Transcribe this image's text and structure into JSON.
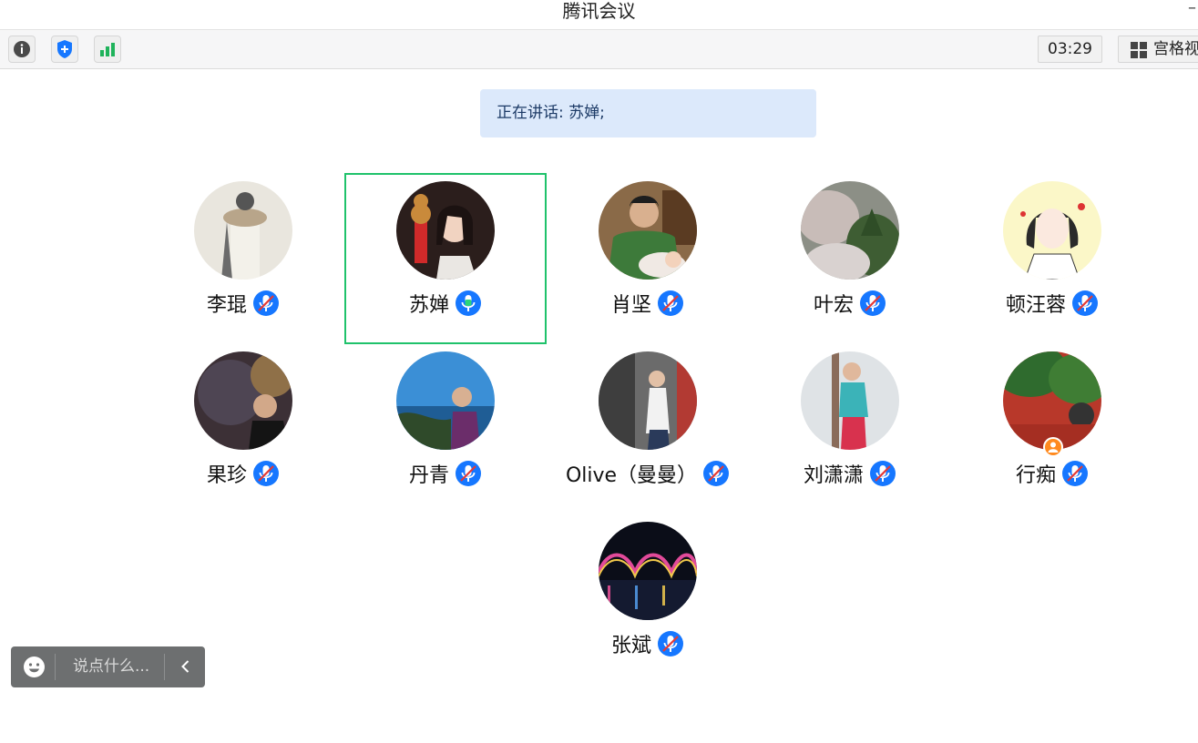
{
  "window": {
    "title": "腾讯会议",
    "minimize_glyph": "–"
  },
  "toolbar": {
    "info_icon": "info-icon",
    "security_icon": "shield-icon",
    "signal_icon": "signal-bars-icon",
    "timer": "03:29",
    "view_label": "宫格视图"
  },
  "banner": {
    "text": "正在讲话: 苏婵;"
  },
  "participants": [
    {
      "name": "李琨",
      "mic": "muted"
    },
    {
      "name": "苏婵",
      "mic": "speaking"
    },
    {
      "name": "肖坚",
      "mic": "muted"
    },
    {
      "name": "叶宏",
      "mic": "muted"
    },
    {
      "name": "顿汪蓉",
      "mic": "muted"
    },
    {
      "name": "果珍",
      "mic": "muted"
    },
    {
      "name": "丹青",
      "mic": "muted"
    },
    {
      "name": "Olive（曼曼）",
      "mic": "muted"
    },
    {
      "name": "刘潇潇",
      "mic": "muted"
    },
    {
      "name": "行痴",
      "mic": "muted",
      "host": true
    },
    {
      "name": "张斌",
      "mic": "muted"
    }
  ],
  "chat": {
    "placeholder": "说点什么..."
  },
  "colors": {
    "accent_blue": "#1677ff",
    "active_green": "#1fc26b",
    "host_orange": "#ff8a1f"
  }
}
